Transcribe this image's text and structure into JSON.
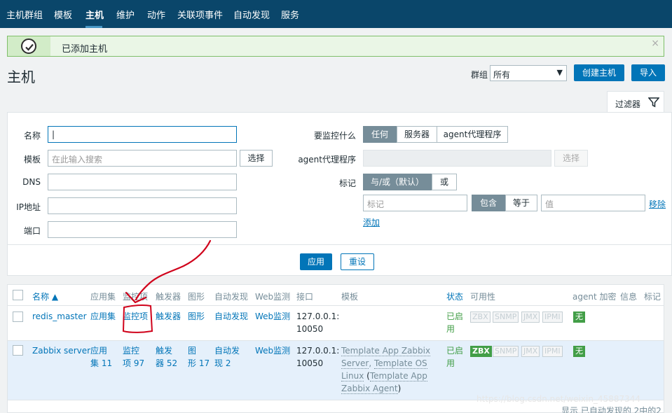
{
  "nav": {
    "items": [
      "主机群组",
      "模板",
      "主机",
      "维护",
      "动作",
      "关联项事件",
      "自动发现",
      "服务"
    ],
    "active": "主机"
  },
  "message": {
    "text": "已添加主机",
    "close": "×"
  },
  "page": {
    "title": "主机",
    "group_label": "群组",
    "group_value": "所有",
    "create_button": "创建主机",
    "import_button": "导入"
  },
  "filter": {
    "tab_label": "过滤器",
    "name_label": "名称",
    "template_label": "模板",
    "template_placeholder": "在此输入搜索",
    "select_button": "选择",
    "dns_label": "DNS",
    "ip_label": "IP地址",
    "port_label": "端口",
    "monitor_label": "要监控什么",
    "monitor_options": [
      "任何",
      "服务器",
      "agent代理程序"
    ],
    "proxy_label": "agent代理程序",
    "proxy_select_button": "选择",
    "tags_label": "标记",
    "tags_mode": [
      "与/或（默认）",
      "或"
    ],
    "tag_placeholder": "标记",
    "tag_ops": [
      "包含",
      "等于"
    ],
    "value_placeholder": "值",
    "remove_link": "移除",
    "add_link": "添加",
    "apply_button": "应用",
    "reset_button": "重设"
  },
  "table": {
    "columns": [
      "名称 ▲",
      "应用集",
      "监控项",
      "触发器",
      "图形",
      "自动发现",
      "Web监测",
      "接口",
      "模板",
      "状态",
      "可用性",
      "agent 加密",
      "信息",
      "标记"
    ],
    "rows": [
      {
        "name": "redis_master",
        "apps": "应用集",
        "items": "监控项",
        "triggers": "触发器",
        "graphs": "图形",
        "discovery": "自动发现",
        "web": "Web监测",
        "interface_1": "127.0.0.1:",
        "interface_2": "10050",
        "status_1": "已启",
        "status_2": "用",
        "avail": [
          "ZBX",
          "SNMP",
          "JMX",
          "IPMI"
        ],
        "encryption": "无"
      },
      {
        "name": "Zabbix server",
        "apps_1": "应用",
        "apps_2": "集 11",
        "items_1": "监控",
        "items_2": "项 97",
        "triggers_1": "触发",
        "triggers_2": "器 52",
        "graphs_1": "图",
        "graphs_2": "形 17",
        "discovery_1": "自动发",
        "discovery_2": "现 2",
        "web": "Web监测",
        "interface_1": "127.0.0.1:",
        "interface_2": "10050",
        "tmpl_1": "Template App Zabbix",
        "tmpl_2": "Server",
        "tmpl_3": "Template OS",
        "tmpl_4": "Linux",
        "tmpl_5": "Template App",
        "tmpl_6": "Zabbix Agent",
        "status_1": "已启",
        "status_2": "用",
        "avail": [
          "ZBX",
          "SNMP",
          "JMX",
          "IPMI"
        ],
        "encryption": "无"
      }
    ],
    "footer": "显示 已自动发现的 2中的2"
  },
  "watermark": "https://blog.csdn.net/weixin_45887344",
  "colors": {
    "nav_bg": "#0a466a",
    "accent": "#0275b8",
    "success": "#429e47",
    "annotation": "#d0021b"
  }
}
